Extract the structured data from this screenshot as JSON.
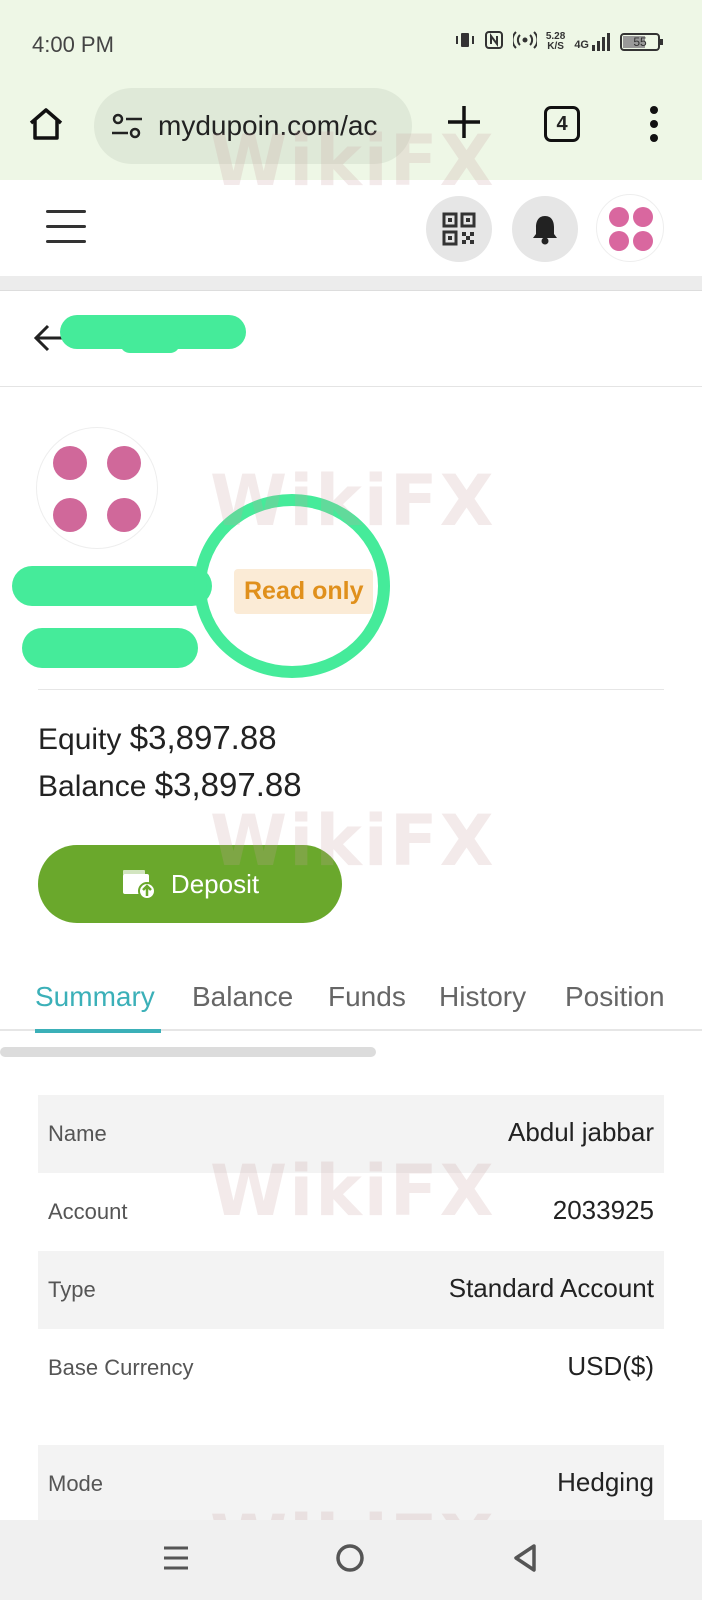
{
  "status_bar": {
    "time": "4:00 PM",
    "network_speed_value": "5.28",
    "network_speed_unit": "K/S",
    "network_type": "4G",
    "battery": "55"
  },
  "browser": {
    "url": "mydupoin.com/ac",
    "tab_count": "4"
  },
  "account_card": {
    "badge": "Read only",
    "equity_label": "Equity",
    "equity_value": "$3,897.88",
    "balance_label": "Balance",
    "balance_value": "$3,897.88",
    "deposit_label": "Deposit"
  },
  "tabs": [
    {
      "label": "Summary",
      "active": true
    },
    {
      "label": "Balance",
      "active": false
    },
    {
      "label": "Funds",
      "active": false
    },
    {
      "label": "History",
      "active": false
    },
    {
      "label": "Position",
      "active": false
    }
  ],
  "summary": [
    {
      "label": "Name",
      "value": "Abdul jabbar"
    },
    {
      "label": "Account",
      "value": "2033925"
    },
    {
      "label": "Type",
      "value": "Standard Account"
    },
    {
      "label": "Base Currency",
      "value": "USD($)"
    },
    {
      "label": "Mode",
      "value": "Hedging"
    }
  ],
  "watermark": "WikiFX",
  "colors": {
    "accent_teal": "#3bb0b8",
    "deposit_green": "#6aa82c",
    "badge_orange": "#e0901c",
    "avatar_pink": "#d9679f",
    "redaction_green": "#45eb9a"
  },
  "icons": {
    "home": "home-icon",
    "site_settings": "tune-icon",
    "new_tab": "plus-icon",
    "tabs": "tab-count-icon",
    "more": "more-vertical-icon",
    "menu": "hamburger-icon",
    "qr": "qr-code-icon",
    "notifications": "bell-icon",
    "back": "arrow-left-icon",
    "deposit": "wallet-upload-icon"
  }
}
